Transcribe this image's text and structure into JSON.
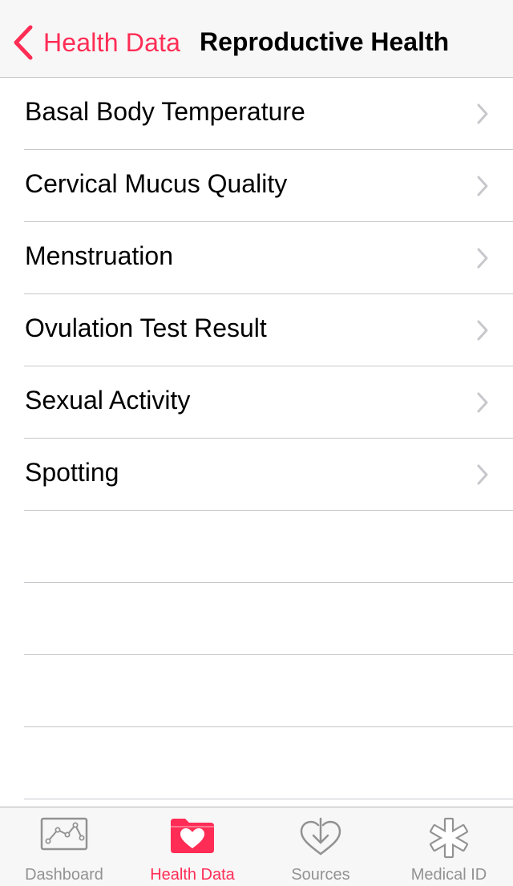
{
  "colors": {
    "accent": "#ff2d55",
    "inactive": "#929292",
    "separator": "#c8c7cc",
    "chevron": "#c7c7cc"
  },
  "navbar": {
    "back_icon": "chevron-left-icon",
    "back_label": "Health Data",
    "title": "Reproductive Health"
  },
  "list": {
    "items": [
      {
        "label": "Basal Body Temperature"
      },
      {
        "label": "Cervical Mucus Quality"
      },
      {
        "label": "Menstruation"
      },
      {
        "label": "Ovulation Test Result"
      },
      {
        "label": "Sexual Activity"
      },
      {
        "label": "Spotting"
      }
    ]
  },
  "tabbar": {
    "tabs": [
      {
        "label": "Dashboard",
        "icon": "dashboard-chart-icon",
        "active": false
      },
      {
        "label": "Health Data",
        "icon": "health-data-folder-heart-icon",
        "active": true
      },
      {
        "label": "Sources",
        "icon": "sources-heart-download-icon",
        "active": false
      },
      {
        "label": "Medical ID",
        "icon": "medical-id-asterisk-icon",
        "active": false
      }
    ]
  }
}
